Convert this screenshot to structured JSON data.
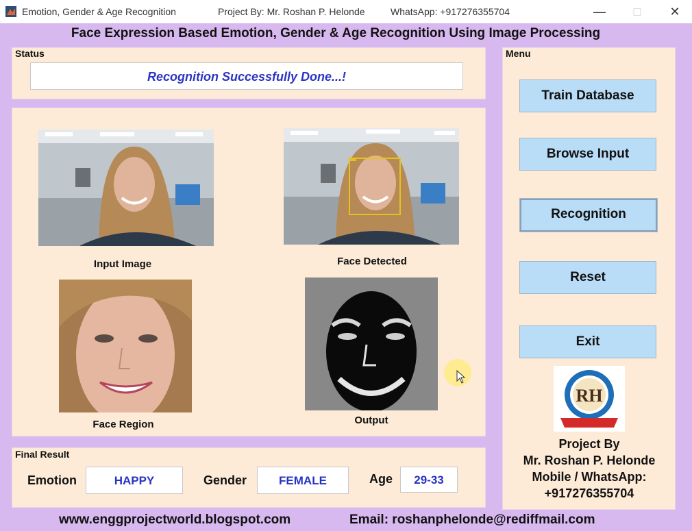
{
  "window": {
    "title": "Emotion, Gender & Age Recognition",
    "project_by": "Project By: Mr. Roshan P. Helonde",
    "whatsapp": "WhatsApp: +917276355704"
  },
  "header": {
    "title": "Face Expression Based Emotion, Gender & Age Recognition Using Image Processing"
  },
  "status": {
    "legend": "Status",
    "message": "Recognition Successfully Done...!"
  },
  "images": {
    "input_caption": "Input Image",
    "detected_caption": "Face Detected",
    "region_caption": "Face Region",
    "output_caption": "Output"
  },
  "menu": {
    "legend": "Menu",
    "train": "Train Database",
    "browse": "Browse Input",
    "recognition": "Recognition",
    "reset": "Reset",
    "exit": "Exit"
  },
  "result": {
    "legend": "Final Result",
    "emotion_label": "Emotion",
    "emotion_value": "HAPPY",
    "gender_label": "Gender",
    "gender_value": "FEMALE",
    "age_label": "Age",
    "age_value": "29-33"
  },
  "project": {
    "line1": "Project By",
    "line2": "Mr. Roshan P. Helonde",
    "line3": "Mobile / WhatsApp:",
    "line4": "+917276355704"
  },
  "footer": {
    "website": "www.enggprojectworld.blogspot.com",
    "email": "Email: roshanphelonde@rediffmail.com"
  },
  "colors": {
    "background": "#d7b8ef",
    "panel": "#fdebd7",
    "button": "#b9dcf7",
    "value_text": "#2632c4"
  }
}
